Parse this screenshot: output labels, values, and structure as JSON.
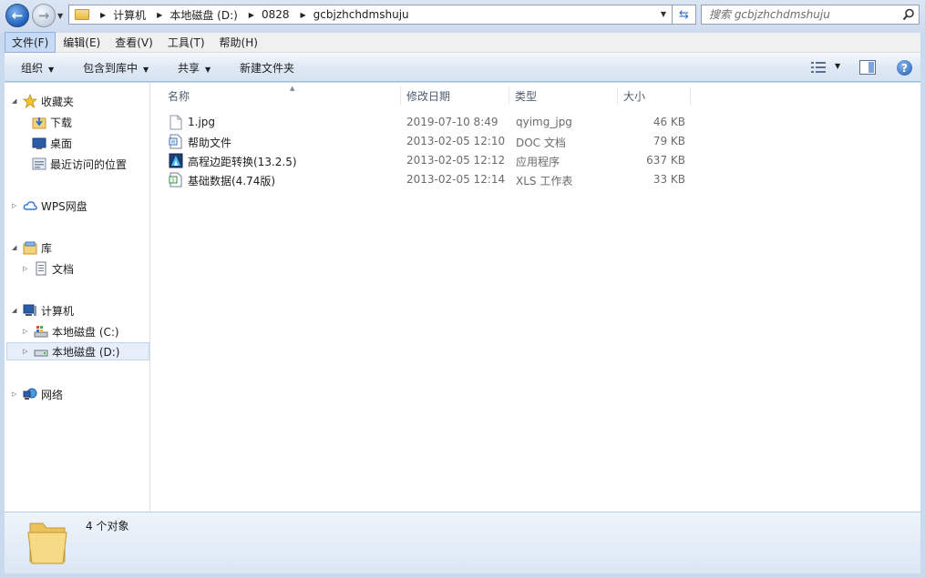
{
  "address": {
    "crumbs": [
      "计算机",
      "本地磁盘 (D:)",
      "0828",
      "gcbjzhchdmshuju"
    ]
  },
  "search": {
    "placeholder": "搜索 gcbjzhchdmshuju"
  },
  "menu": [
    "文件(F)",
    "编辑(E)",
    "查看(V)",
    "工具(T)",
    "帮助(H)"
  ],
  "commands": {
    "organize": "组织",
    "include": "包含到库中",
    "share": "共享",
    "newfolder": "新建文件夹"
  },
  "nav": {
    "favorites": "收藏夹",
    "downloads": "下载",
    "desktop": "桌面",
    "recent": "最近访问的位置",
    "wps": "WPS网盘",
    "libraries": "库",
    "documents": "文档",
    "computer": "计算机",
    "drive_c": "本地磁盘 (C:)",
    "drive_d": "本地磁盘 (D:)",
    "network": "网络"
  },
  "columns": {
    "name": "名称",
    "date": "修改日期",
    "type": "类型",
    "size": "大小"
  },
  "files": [
    {
      "name": "1.jpg",
      "date": "2019-07-10 8:49",
      "type": "qyimg_jpg",
      "size": "46 KB",
      "icon": "blank-file-icon"
    },
    {
      "name": "帮助文件",
      "date": "2013-02-05 12:10",
      "type": "DOC 文档",
      "size": "79 KB",
      "icon": "doc-file-icon"
    },
    {
      "name": "高程边距转换(13.2.5)",
      "date": "2013-02-05 12:12",
      "type": "应用程序",
      "size": "637 KB",
      "icon": "app-icon"
    },
    {
      "name": "基础数据(4.74版)",
      "date": "2013-02-05 12:14",
      "type": "XLS 工作表",
      "size": "33 KB",
      "icon": "xls-file-icon"
    }
  ],
  "status": {
    "count": "4 个对象"
  },
  "colors": {
    "accent": "#1f5fb8",
    "chrome": "#c9d9ee"
  }
}
